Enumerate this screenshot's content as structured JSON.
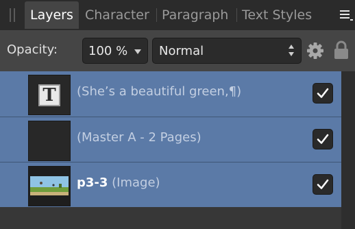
{
  "tabs": [
    {
      "label": "Layers",
      "active": true
    },
    {
      "label": "Character",
      "active": false
    },
    {
      "label": "Paragraph",
      "active": false
    },
    {
      "label": "Text Styles",
      "active": false
    }
  ],
  "toolbar": {
    "opacity_label": "Opacity:",
    "opacity_value": "100 %",
    "blend_mode": "Normal",
    "icons": [
      "gear-icon",
      "lock-icon"
    ]
  },
  "layers": [
    {
      "thumbnail": "T",
      "name_bold": "",
      "name_meta": "(She’s a beautiful green,¶)",
      "visible": true
    },
    {
      "thumbnail": "",
      "name_bold": "",
      "name_meta": "(Master A - 2 Pages)",
      "visible": true
    },
    {
      "thumbnail": "image",
      "name_bold": "p3-3",
      "name_meta": " (Image)",
      "visible": true
    }
  ],
  "colors": {
    "selected_row": "#5b7aa7",
    "panel": "#454545",
    "background": "#2e2e2e",
    "marker": "#e6762b"
  }
}
